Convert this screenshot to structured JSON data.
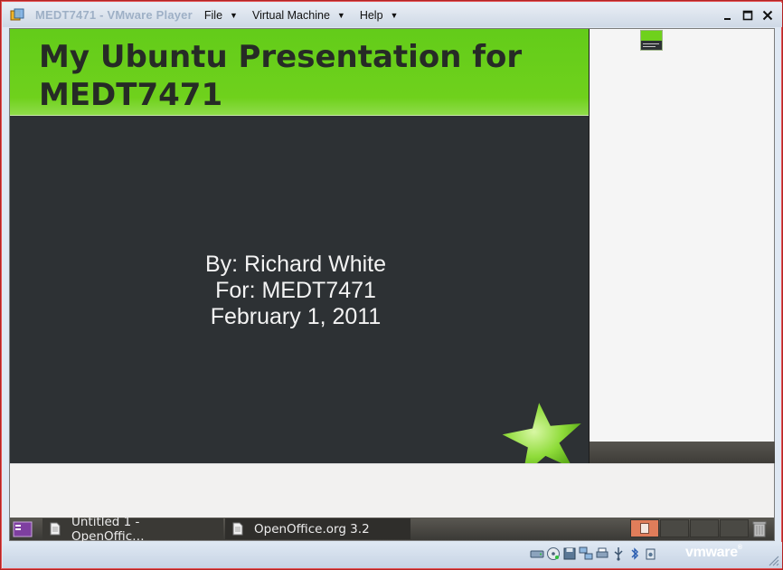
{
  "window": {
    "title": "MEDT7471 - VMware Player",
    "menu": [
      {
        "label": "File"
      },
      {
        "label": "Virtual Machine"
      },
      {
        "label": "Help"
      }
    ],
    "controls": {
      "minimize": "▁",
      "maximize": "□",
      "close": "✕"
    }
  },
  "slide": {
    "title": "My Ubuntu Presentation for MEDT7471",
    "lines": [
      "By: Richard White",
      "For: MEDT7471",
      "February 1, 2011"
    ],
    "colors": {
      "header": "#6fd11c",
      "body": "#2d3134"
    }
  },
  "taskbar": {
    "tasks": [
      {
        "label": "Untitled 1 - OpenOffic…",
        "icon": "document-icon"
      },
      {
        "label": "OpenOffice.org 3.2",
        "icon": "document-icon"
      }
    ],
    "workspaces": 4,
    "active_workspace": 1
  },
  "statusbar": {
    "devices": [
      "hard-disk-icon",
      "cd-rom-icon",
      "floppy-icon",
      "network-icon",
      "printer-icon",
      "usb-icon",
      "bluetooth-icon",
      "sound-icon"
    ],
    "brand": "vm",
    "brand_suffix": "ware"
  }
}
